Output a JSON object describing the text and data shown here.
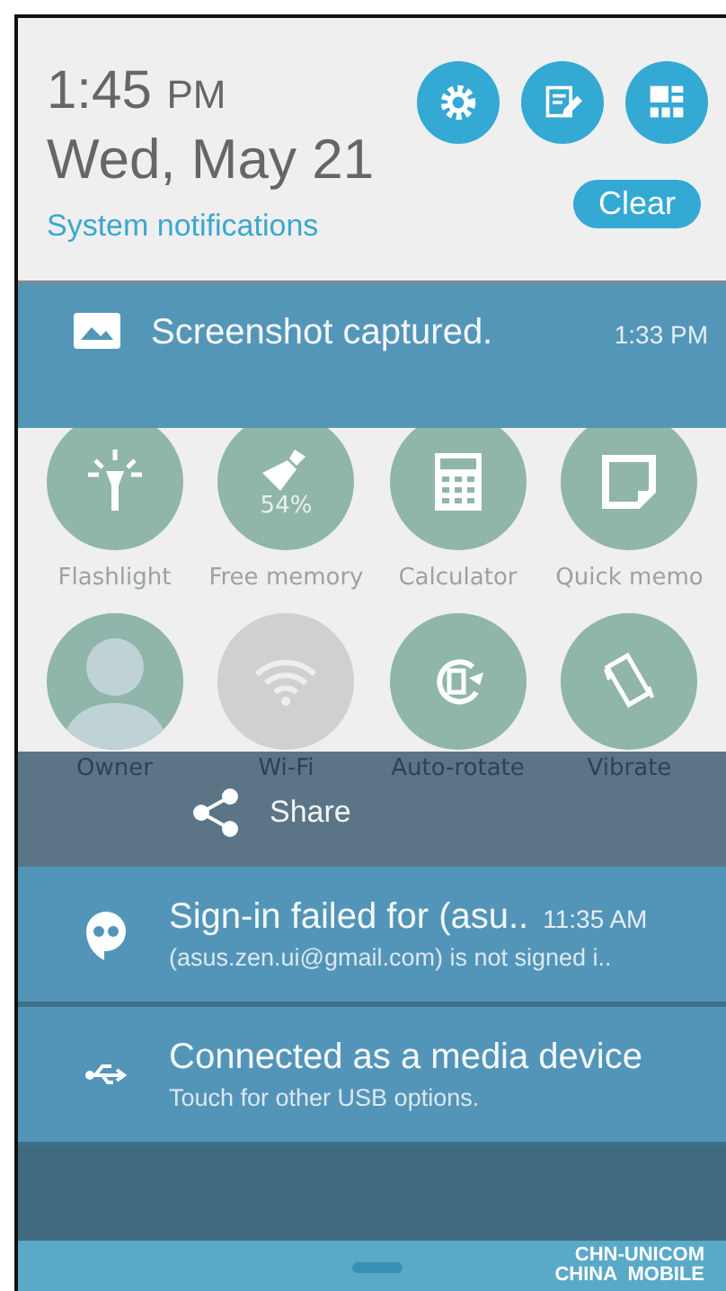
{
  "header": {
    "time": "1:45",
    "ampm": "PM",
    "date": "Wed, May 21",
    "link": "System notifications",
    "actions": [
      {
        "kind": "settings"
      },
      {
        "kind": "edit"
      },
      {
        "kind": "apps"
      }
    ],
    "clear": "Clear"
  },
  "top_notification": {
    "kind": "image",
    "title": "Screenshot captured.",
    "time": "1:33 PM"
  },
  "quick_settings": [
    {
      "kind": "flashlight",
      "label": "Flashlight",
      "on": true
    },
    {
      "kind": "memory",
      "label": "Free memory",
      "on": true,
      "badge": "54%"
    },
    {
      "kind": "calculator",
      "label": "Calculator",
      "on": true
    },
    {
      "kind": "memo",
      "label": "Quick memo",
      "on": true
    },
    {
      "kind": "owner",
      "label": "Owner",
      "on": true
    },
    {
      "kind": "wifi",
      "label": "Wi-Fi",
      "on": false
    },
    {
      "kind": "rotate",
      "label": "Auto-rotate",
      "on": true
    },
    {
      "kind": "vibrate",
      "label": "Vibrate",
      "on": true
    }
  ],
  "share": {
    "label": "Share"
  },
  "notifications": [
    {
      "kind": "chat",
      "title": "Sign-in failed for (asu..",
      "time": "11:35 AM",
      "text": "(asus.zen.ui@gmail.com) is not signed i.."
    },
    {
      "kind": "usb",
      "title": "Connected as a media device",
      "text": "Touch for other USB options."
    }
  ],
  "carriers": [
    "CHN-UNICOM",
    "CHINA  MOBILE"
  ]
}
